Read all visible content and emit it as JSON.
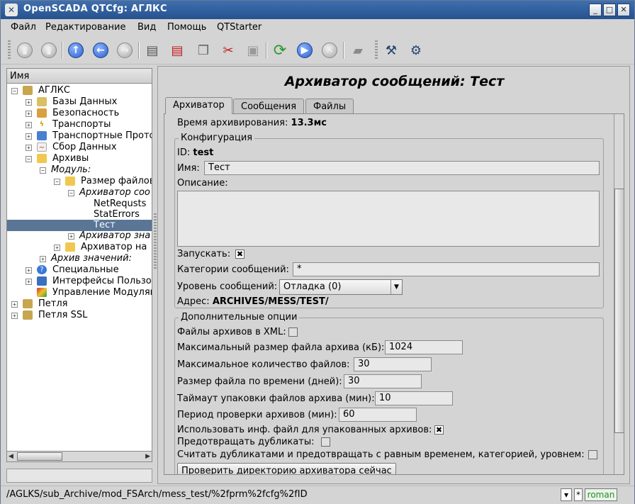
{
  "window": {
    "title": "OpenSCADA QTCfg: АГЛКС"
  },
  "menu": [
    "Файл",
    "Редактирование",
    "Вид",
    "Помощь",
    "QTStarter"
  ],
  "tree": {
    "header": "Имя",
    "items": [
      "АГЛКС",
      "Базы Данных",
      "Безопасность",
      "Транспорты",
      "Транспортные Прото",
      "Сбор Данных",
      "Архивы",
      "Модуль:",
      "Размер файлов",
      "Архиватор соо",
      "NetRequsts",
      "StatErrors",
      "Тест",
      "Архиватор зна",
      "Архиватор на",
      "Архив значений:",
      "Специальные",
      "Интерфейсы Пользо",
      "Управление Модулям",
      "Петля",
      "Петля SSL"
    ]
  },
  "page": {
    "title": "Архиватор сообщений: Тест",
    "tabs": [
      "Архиватор",
      "Сообщения",
      "Файлы"
    ],
    "arch_time_label": "Время архивирования:",
    "arch_time_value": "13.3мс",
    "config": {
      "title": "Конфигурация",
      "id_label": "ID:",
      "id_value": "test",
      "name_label": "Имя:",
      "name_value": "Тест",
      "descr_label": "Описание:",
      "start_label": "Запускать:",
      "start_mark": "✖",
      "categories_label": "Категории сообщений:",
      "categories_value": "*",
      "level_label": "Уровень сообщений:",
      "level_value": "Отладка (0)",
      "address_label": "Адрес:",
      "address_value": "ARCHIVES/MESS/TEST/"
    },
    "extra": {
      "title": "Дополнительные опции",
      "xml_label": "Файлы архивов в XML:",
      "max_size_label": "Максимальный размер файла архива (кБ):",
      "max_size_value": "1024",
      "max_count_label": "Максимальное количество файлов:",
      "max_count_value": "30",
      "time_size_label": "Размер файла по времени (дней):",
      "time_size_value": "30",
      "pack_timeout_label": "Таймаут упаковки файлов архива (мин):",
      "pack_timeout_value": "10",
      "check_period_label": "Период проверки архивов (мин):",
      "check_period_value": "60",
      "use_info_label": "Использовать инф. файл для упакованных архивов:",
      "use_info_mark": "✖",
      "prevent_dup_label": "Предотвращать дубликаты:",
      "dup_equal_label": "Считать дубликатами и предотвращать с равным временем, категорией, уровнем:",
      "check_dir_button": "Проверить директорию архиватора сейчас"
    }
  },
  "status": {
    "path": "/AGLKS/sub_Archive/mod_FSArch/mess_test/%2fprm%2fcfg%2fID",
    "mod_mark": "*",
    "user": "roman"
  }
}
